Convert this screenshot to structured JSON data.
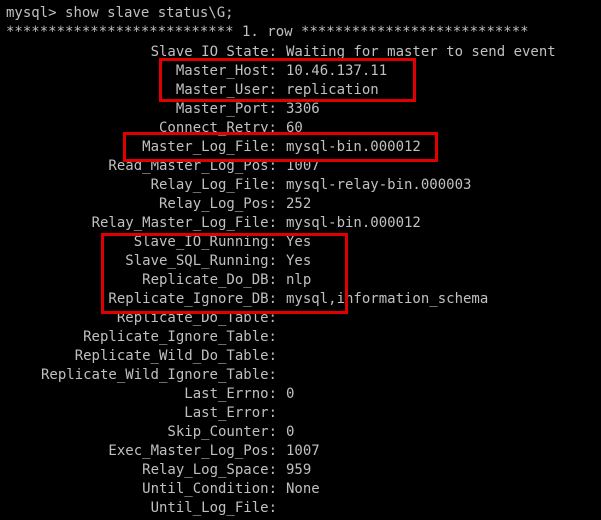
{
  "terminal": {
    "prompt": "mysql> ",
    "command": "show slave status\\G;",
    "separator_left": "***************************",
    "row_label": " 1. row ",
    "separator_right": "***************************"
  },
  "fields": [
    {
      "label": "Slave_IO_State:",
      "value": "Waiting for master to send event"
    },
    {
      "label": "Master_Host:",
      "value": "10.46.137.11"
    },
    {
      "label": "Master_User:",
      "value": "replication"
    },
    {
      "label": "Master_Port:",
      "value": "3306"
    },
    {
      "label": "Connect_Retry:",
      "value": "60"
    },
    {
      "label": "Master_Log_File:",
      "value": "mysql-bin.000012"
    },
    {
      "label": "Read_Master_Log_Pos:",
      "value": "1007"
    },
    {
      "label": "Relay_Log_File:",
      "value": "mysql-relay-bin.000003"
    },
    {
      "label": "Relay_Log_Pos:",
      "value": "252"
    },
    {
      "label": "Relay_Master_Log_File:",
      "value": "mysql-bin.000012"
    },
    {
      "label": "Slave_IO_Running:",
      "value": "Yes"
    },
    {
      "label": "Slave_SQL_Running:",
      "value": "Yes"
    },
    {
      "label": "Replicate_Do_DB:",
      "value": "nlp"
    },
    {
      "label": "Replicate_Ignore_DB:",
      "value": "mysql,information_schema"
    },
    {
      "label": "Replicate_Do_Table:",
      "value": ""
    },
    {
      "label": "Replicate_Ignore_Table:",
      "value": ""
    },
    {
      "label": "Replicate_Wild_Do_Table:",
      "value": ""
    },
    {
      "label": "Replicate_Wild_Ignore_Table:",
      "value": ""
    },
    {
      "label": "Last_Errno:",
      "value": "0"
    },
    {
      "label": "Last_Error:",
      "value": ""
    },
    {
      "label": "Skip_Counter:",
      "value": "0"
    },
    {
      "label": "Exec_Master_Log_Pos:",
      "value": "1007"
    },
    {
      "label": "Relay_Log_Space:",
      "value": "959"
    },
    {
      "label": "Until_Condition:",
      "value": "None"
    },
    {
      "label": "Until_Log_File:",
      "value": ""
    }
  ],
  "colors": {
    "background": "#000000",
    "text": "#c0c0c0",
    "highlight_border": "#e00000"
  }
}
